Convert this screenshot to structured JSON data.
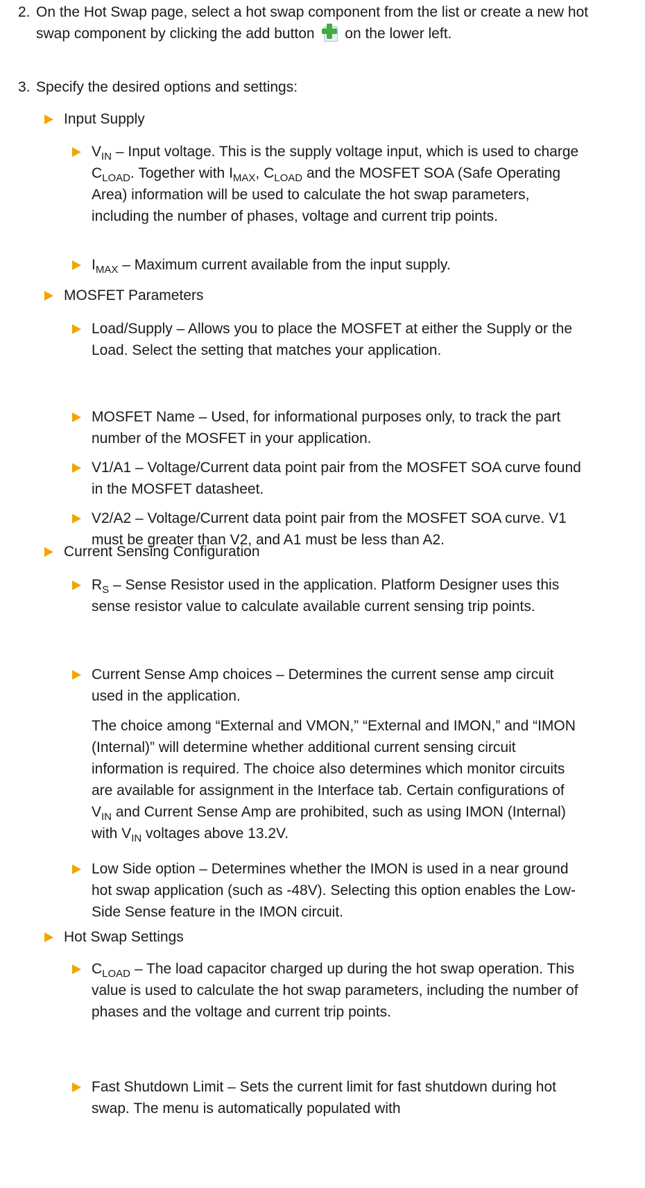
{
  "steps": [
    {
      "num": "2.",
      "text_before_icon": "On the Hot Swap page, select a hot swap component from the list or create a new hot swap component by clicking the add button",
      "text_after_icon": "on the lower left.",
      "icon": "add-button-icon"
    },
    {
      "num": "3.",
      "text": "Specify the desired options and settings:"
    }
  ],
  "sections": {
    "input_supply": {
      "title": "Input Supply",
      "vin": {
        "sym": "V",
        "sub": "IN",
        "t1": " – Input voltage. This is the supply voltage input, which is used to charge ",
        "cload_sym": "C",
        "cload_sub": "LOAD",
        "t2": ". Together with ",
        "imax_sym": "I",
        "imax_sub": "MAX",
        "t3": ", ",
        "cload2_sym": "C",
        "cload2_sub": "LOAD",
        "t4": " and the MOSFET SOA (Safe Operating Area) information will be used to calculate the hot swap parameters, including the number of phases, voltage and current trip points."
      },
      "imax": {
        "sym": "I",
        "sub": "MAX",
        "t1": " – Maximum current available from the input supply."
      }
    },
    "mosfet": {
      "title": "MOSFET Parameters",
      "items": [
        "Load/Supply – Allows you to place the MOSFET at either the Supply or the Load. Select the setting that matches your application.",
        "MOSFET Name – Used, for informational purposes only, to track the part number of the MOSFET in your application.",
        "V1/A1 – Voltage/Current data point pair from the MOSFET SOA curve found in the MOSFET datasheet.",
        "V2/A2 – Voltage/Current data point pair from the MOSFET SOA curve. V1 must be greater than V2, and A1 must be less than A2."
      ]
    },
    "current_sensing": {
      "title": "Current Sensing Configuration",
      "rs": {
        "sym": "R",
        "sub": "S",
        "t1": " – Sense Resistor used in the application. Platform Designer uses this sense resistor value to calculate available current sensing trip points."
      },
      "amp": "Current Sense Amp choices – Determines the current sense amp circuit used in the application.",
      "amp_para": {
        "t1": "The choice among “External and VMON,” “External and IMON,” and “IMON (Internal)” will determine whether additional current sensing circuit information is required. The choice also determines which monitor circuits are available for assignment in the Interface tab. Certain configurations of ",
        "vin_sym": "V",
        "vin_sub": "IN",
        "t2": " and Current Sense Amp are prohibited, such as using IMON (Internal) with ",
        "vin2_sym": "V",
        "vin2_sub": "IN",
        "t3": " voltages above 13.2V."
      },
      "low_side": "Low Side option – Determines whether the IMON is used in a near ground hot swap application (such as -48V). Selecting this option enables the Low-Side Sense feature in the IMON circuit."
    },
    "hot_swap": {
      "title": "Hot Swap Settings",
      "cload": {
        "sym": "C",
        "sub": "LOAD",
        "t1": " – The load capacitor charged up during the hot swap operation. This value is used to calculate the hot swap parameters, including the number of phases and the voltage and current trip points."
      },
      "fast_shutdown": "Fast Shutdown Limit – Sets the current limit for fast shutdown during hot swap. The menu is automatically populated with"
    }
  },
  "colors": {
    "bullet": "#f2a500",
    "text": "#1a1a1a",
    "add_icon_plus": "#3fae3f"
  }
}
